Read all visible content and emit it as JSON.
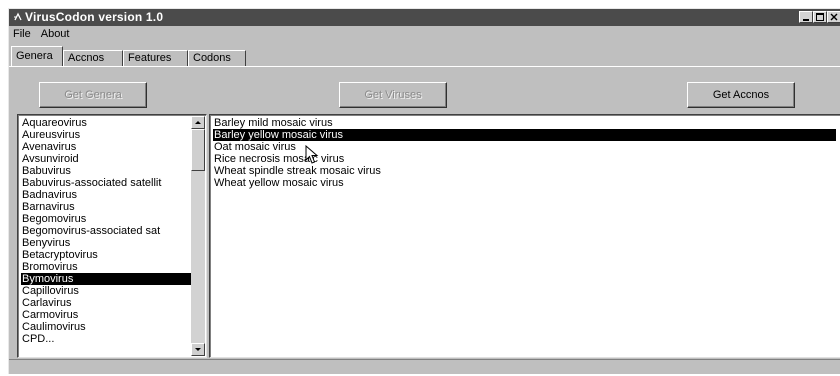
{
  "window": {
    "title": "VirusCodon version 1.0"
  },
  "menu": [
    "File",
    "About"
  ],
  "tabs": [
    "Genera",
    "Accnos",
    "Features",
    "Codons"
  ],
  "buttons": {
    "get_genera": "Get Genera",
    "get_viruses": "Get Viruses",
    "get_accnos": "Get Accnos"
  },
  "genera": {
    "items": [
      "Aquareovirus",
      "Aureusvirus",
      "Avenavirus",
      "Avsunviroid",
      "Babuvirus",
      "Babuvirus-associated satellit",
      "Badnavirus",
      "Barnavirus",
      "Begomovirus",
      "Begomovirus-associated sat",
      "Benyvirus",
      "Betacryptovirus",
      "Bromovirus",
      "Bymovirus",
      "Capillovirus",
      "Carlavirus",
      "Carmovirus",
      "Caulimovirus",
      "CPD..."
    ],
    "selected": "Bymovirus"
  },
  "viruses": {
    "items": [
      "Barley mild mosaic virus",
      "Barley yellow mosaic virus",
      "Oat mosaic virus",
      "Rice necrosis mosaic virus",
      "Wheat spindle streak mosaic virus",
      "Wheat yellow mosaic virus"
    ],
    "selected": "Barley yellow mosaic virus"
  },
  "icons": {
    "app": "virus-app-icon",
    "minimize": "minimize-icon",
    "maximize": "maximize-icon",
    "close": "close-icon",
    "scroll_up": "scroll-up-arrow-icon",
    "scroll_down": "scroll-down-arrow-icon",
    "cursor": "mouse-pointer-icon"
  },
  "colors": {
    "title_bar": "#454545",
    "selection": "#000000",
    "window_face": "#c6c6c6"
  }
}
